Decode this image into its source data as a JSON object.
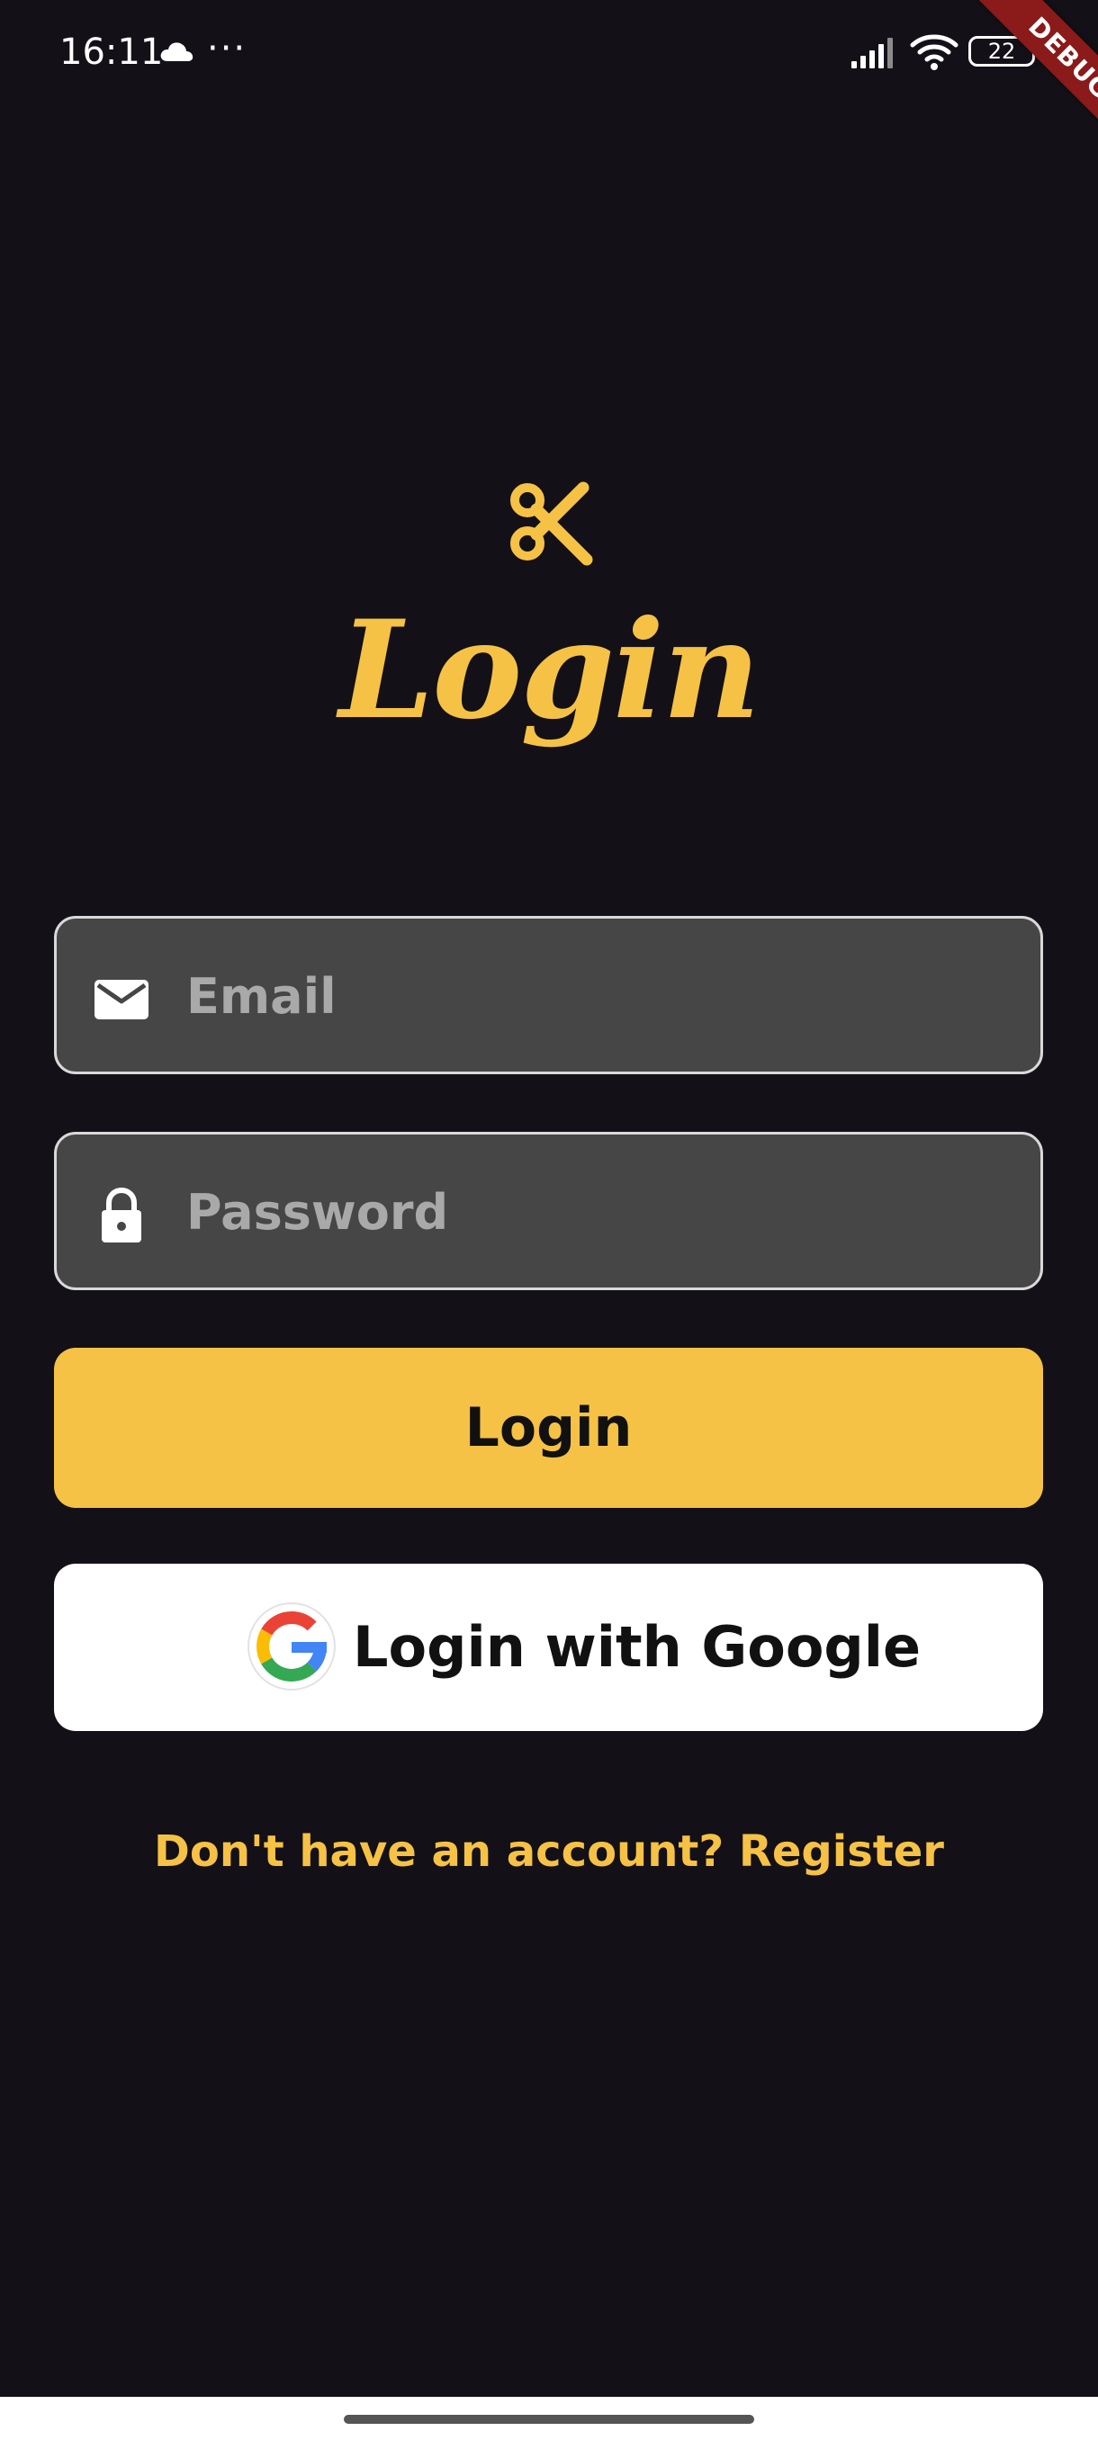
{
  "status_bar": {
    "time": "16:11",
    "more": "···",
    "battery": "22",
    "icons": [
      "cloud-icon",
      "signal-icon",
      "wifi-icon",
      "battery-icon"
    ]
  },
  "debug_banner": "DEBUG",
  "logo": {
    "icon": "scissors-icon",
    "color": "#f6c245"
  },
  "title": "Login",
  "form": {
    "email": {
      "placeholder": "Email",
      "value": "",
      "icon": "mail-icon"
    },
    "password": {
      "placeholder": "Password",
      "value": "",
      "icon": "lock-icon"
    },
    "login_label": "Login",
    "google_label": "Login with Google",
    "google_icon": "google-icon",
    "register_text": "Don't have an account? Register"
  },
  "colors": {
    "background": "#131117",
    "accent": "#f6c245",
    "input_bg": "#464646",
    "input_border": "#d9d9d9"
  }
}
